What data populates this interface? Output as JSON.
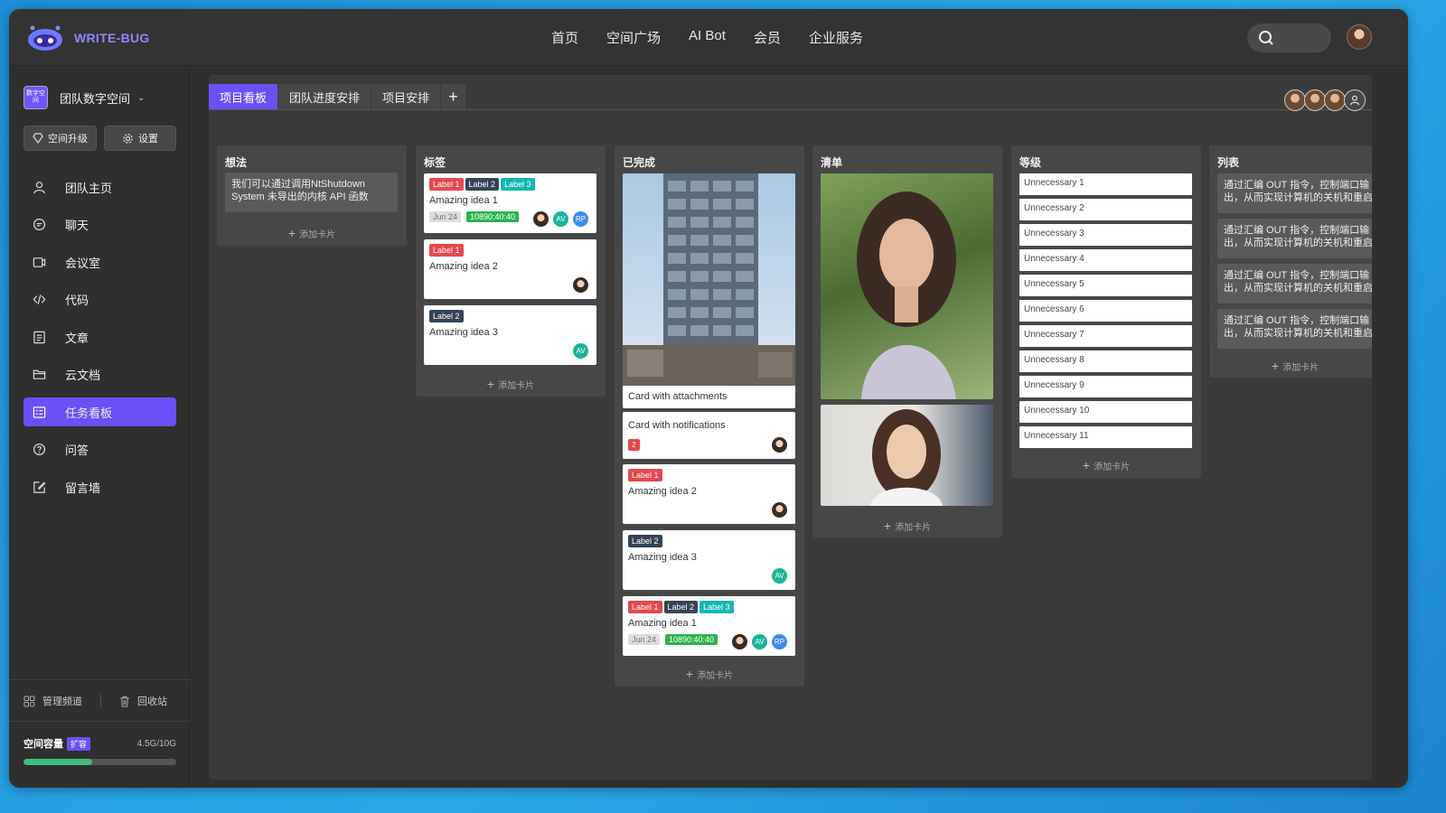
{
  "brand": {
    "name": "WRITE-BUG"
  },
  "nav": [
    "首页",
    "空间广场",
    "AI Bot",
    "会员",
    "企业服务"
  ],
  "sidebar": {
    "space_icon_text": "数字空间",
    "space_name": "团队数字空间",
    "upgrade_label": "空间升级",
    "settings_label": "设置",
    "items": [
      {
        "label": "团队主页",
        "icon": "user-icon"
      },
      {
        "label": "聊天",
        "icon": "chat-icon"
      },
      {
        "label": "会议室",
        "icon": "meeting-icon"
      },
      {
        "label": "代码",
        "icon": "code-icon"
      },
      {
        "label": "文章",
        "icon": "article-icon"
      },
      {
        "label": "云文档",
        "icon": "folder-icon"
      },
      {
        "label": "任务看板",
        "icon": "board-icon",
        "active": true
      },
      {
        "label": "问答",
        "icon": "question-icon"
      },
      {
        "label": "留言墙",
        "icon": "edit-icon"
      }
    ],
    "manage_label": "管理频道",
    "trash_label": "回收站",
    "capacity_label": "空间容量",
    "expand_label": "扩容",
    "capacity_value": "4.5G/10G",
    "capacity_fraction": 0.45
  },
  "tabs": [
    "项目看板",
    "团队进度安排",
    "项目安排",
    "+"
  ],
  "board": {
    "add_card": "添加卡片",
    "columns": {
      "ideas": {
        "title": "想法",
        "note": "我们可以通过调用NtShutdown System 未导出的内核 API 函数"
      },
      "labels": {
        "title": "标签",
        "cards": [
          {
            "labels": [
              "Label 1",
              "Label 2",
              "Label 3"
            ],
            "title": "Amazing idea 1",
            "date": "Jun 24",
            "timer": "10890:40:40",
            "avatars": [
              "AV",
              "RP"
            ]
          },
          {
            "labels": [
              "Label 1"
            ],
            "title": "Amazing idea 2"
          },
          {
            "labels": [
              "Label 2"
            ],
            "title": "Amazing idea 3",
            "avatars": [
              "AV"
            ]
          }
        ]
      },
      "done": {
        "title": "已完成",
        "cards": [
          {
            "title": "Card with attachments"
          },
          {
            "title": "Card with notifications",
            "badge": "2"
          },
          {
            "labels": [
              "Label 1"
            ],
            "title": "Amazing idea 2"
          },
          {
            "labels": [
              "Label 2"
            ],
            "title": "Amazing idea 3",
            "avatars": [
              "AV"
            ]
          },
          {
            "labels": [
              "Label 1",
              "Label 2",
              "Label 3"
            ],
            "title": "Amazing idea 1",
            "date": "Jun 24",
            "timer": "10890:40:40",
            "avatars": [
              "AV",
              "RP"
            ]
          }
        ]
      },
      "list": {
        "title": "清单"
      },
      "levels": {
        "title": "等级",
        "items": [
          "Unnecessary 1",
          "Unnecessary 2",
          "Unnecessary 3",
          "Unnecessary 4",
          "Unnecessary 5",
          "Unnecessary 6",
          "Unnecessary 7",
          "Unnecessary 8",
          "Unnecessary 9",
          "Unnecessary 10",
          "Unnecessary 11"
        ]
      },
      "table": {
        "title": "列表",
        "paragraphs": [
          "通过汇编 OUT 指令，控制端口输出，从而实现计算机的关机和重启",
          "通过汇编 OUT 指令，控制端口输出，从而实现计算机的关机和重启",
          "通过汇编 OUT 指令，控制端口输出，从而实现计算机的关机和重启",
          "通过汇编 OUT 指令，控制端口输出，从而实现计算机的关机和重启"
        ]
      }
    }
  },
  "colors": {
    "accent": "#6a51f5",
    "label_red": "#e5484d",
    "label_dark": "#344457",
    "label_teal": "#13b8b3",
    "timer_green": "#2bb34a"
  }
}
